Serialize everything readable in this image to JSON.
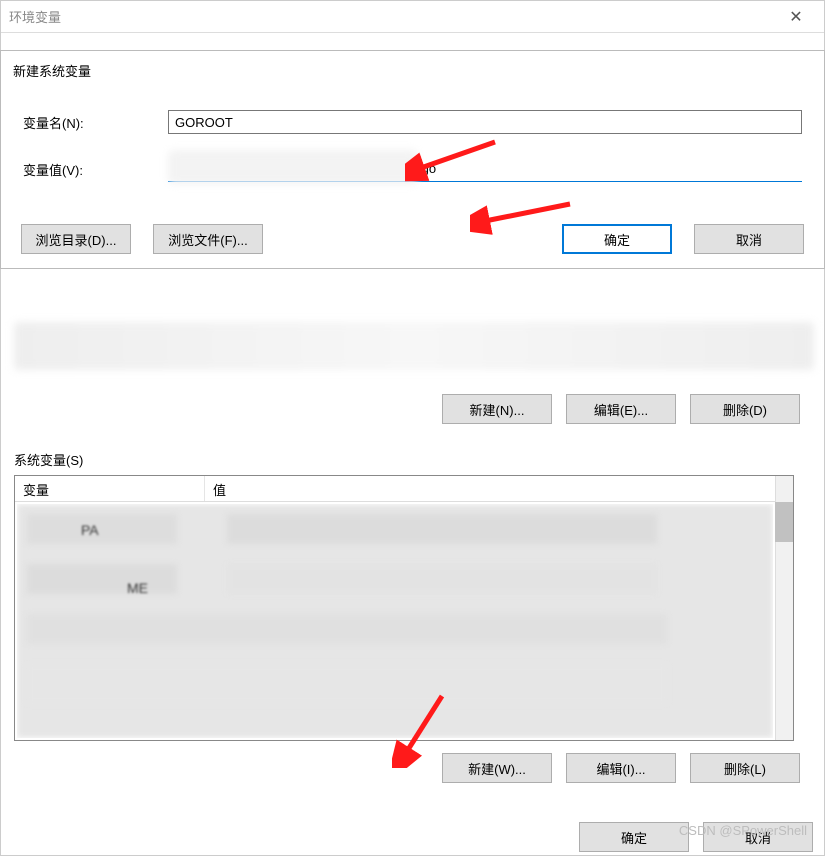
{
  "window": {
    "title": "环境变量"
  },
  "newVar": {
    "header": "新建系统变量",
    "nameLabel": "变量名(N):",
    "nameValue": "GOROOT",
    "valueLabel": "变量值(V):",
    "valueTail": "\\go",
    "browseDir": "浏览目录(D)...",
    "browseFile": "浏览文件(F)...",
    "ok": "确定",
    "cancel": "取消"
  },
  "userButtons": {
    "new": "新建(N)...",
    "edit": "编辑(E)...",
    "delete": "删除(D)"
  },
  "sysVars": {
    "sectionLabel": "系统变量(S)",
    "colVar": "变量",
    "colVal": "值",
    "blurredRowHints": [
      "PA",
      "ME"
    ]
  },
  "sysButtons": {
    "new": "新建(W)...",
    "edit": "编辑(I)...",
    "delete": "删除(L)"
  },
  "bottom": {
    "ok": "确定",
    "cancel": "取消"
  },
  "watermark": "CSDN @SPowerShell"
}
